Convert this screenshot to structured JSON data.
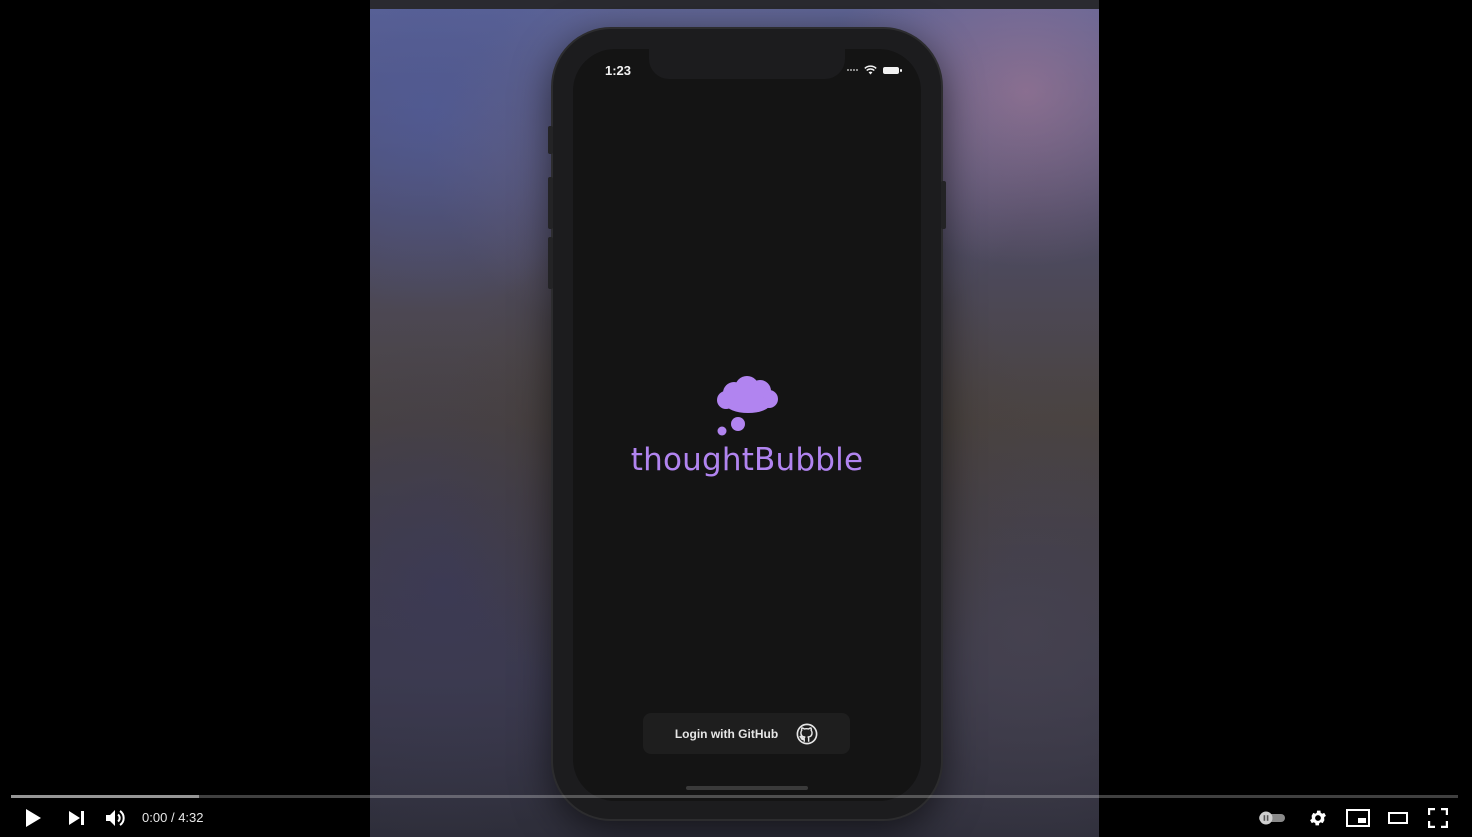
{
  "phone": {
    "status_time": "1:23",
    "app_name": "thoughtBubble",
    "login_label": "Login with GitHub",
    "accent_color": "#b184f0"
  },
  "player": {
    "current_time": "0:00",
    "separator": "/",
    "duration": "4:32",
    "loaded_fraction": 0.13,
    "played_fraction": 0.0,
    "icons": [
      "play-icon",
      "next-icon",
      "volume-icon",
      "autoplay-toggle-icon",
      "settings-gear-icon",
      "miniplayer-icon",
      "theater-mode-icon",
      "fullscreen-icon"
    ]
  }
}
